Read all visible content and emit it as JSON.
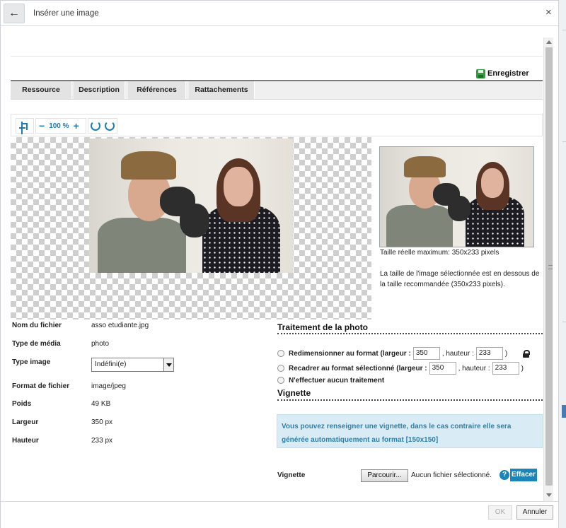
{
  "window": {
    "title": "Insérer une image",
    "back_icon": "arrow-left-icon",
    "close_label": "×"
  },
  "toolbar": {
    "save_label": "Enregistrer",
    "save_icon": "floppy-disk-icon"
  },
  "tabs": [
    {
      "label": "Ressource"
    },
    {
      "label": "Description"
    },
    {
      "label": "Références"
    },
    {
      "label": "Rattachements"
    }
  ],
  "editor": {
    "crop_icon": "crop-icon",
    "zoom_out": "−",
    "zoom_level": "100 %",
    "zoom_in": "+",
    "rotate_left_icon": "rotate-left-icon",
    "rotate_right_icon": "rotate-right-icon"
  },
  "preview": {
    "max_size": "Taille réelle maximum: 350x233 pixels",
    "note": "La taille de l'image sélectionnée est en dessous de la taille recommandée (350x233 pixels)."
  },
  "file_info": {
    "filename_label": "Nom du fichier",
    "filename_value": "asso etudiante.jpg",
    "media_type_label": "Type de média",
    "media_type_value": "photo",
    "image_type_label": "Type image",
    "image_type_value": "Indéfini(e)",
    "format_label": "Format de fichier",
    "format_value": "image/jpeg",
    "weight_label": "Poids",
    "weight_value": "49 KB",
    "width_label": "Largeur",
    "width_value": "350 px",
    "height_label": "Hauteur",
    "height_value": "233 px"
  },
  "processing": {
    "title": "Traitement de la photo",
    "resize_label": "Redimensionner au format (largeur :",
    "resize_width": "350",
    "resize_height_label": ", hauteur :",
    "resize_height": "233",
    "resize_close": ")",
    "crop_label": "Recadrer au format sélectionné (largeur :",
    "crop_width": "350",
    "crop_height_label": ", hauteur :",
    "crop_height": "233",
    "crop_close": ")",
    "none_label": "N'effectuer aucun traitement"
  },
  "thumbnail": {
    "title": "Vignette",
    "info": "Vous pouvez renseigner une vignette, dans le cas contraire elle sera générée automatiquement au format [150x150]",
    "field_label": "Vignette",
    "browse_label": "Parcourir...",
    "no_file": "Aucun fichier sélectionné.",
    "help": "?",
    "clear_label": "Effacer"
  },
  "footer": {
    "ok_label": "OK",
    "cancel_label": "Annuler"
  },
  "colors": {
    "accent": "#1b84b8",
    "save_green": "#2f9e3b",
    "alert_bg": "#d9ecf5",
    "alert_text": "#2f7fa8"
  }
}
